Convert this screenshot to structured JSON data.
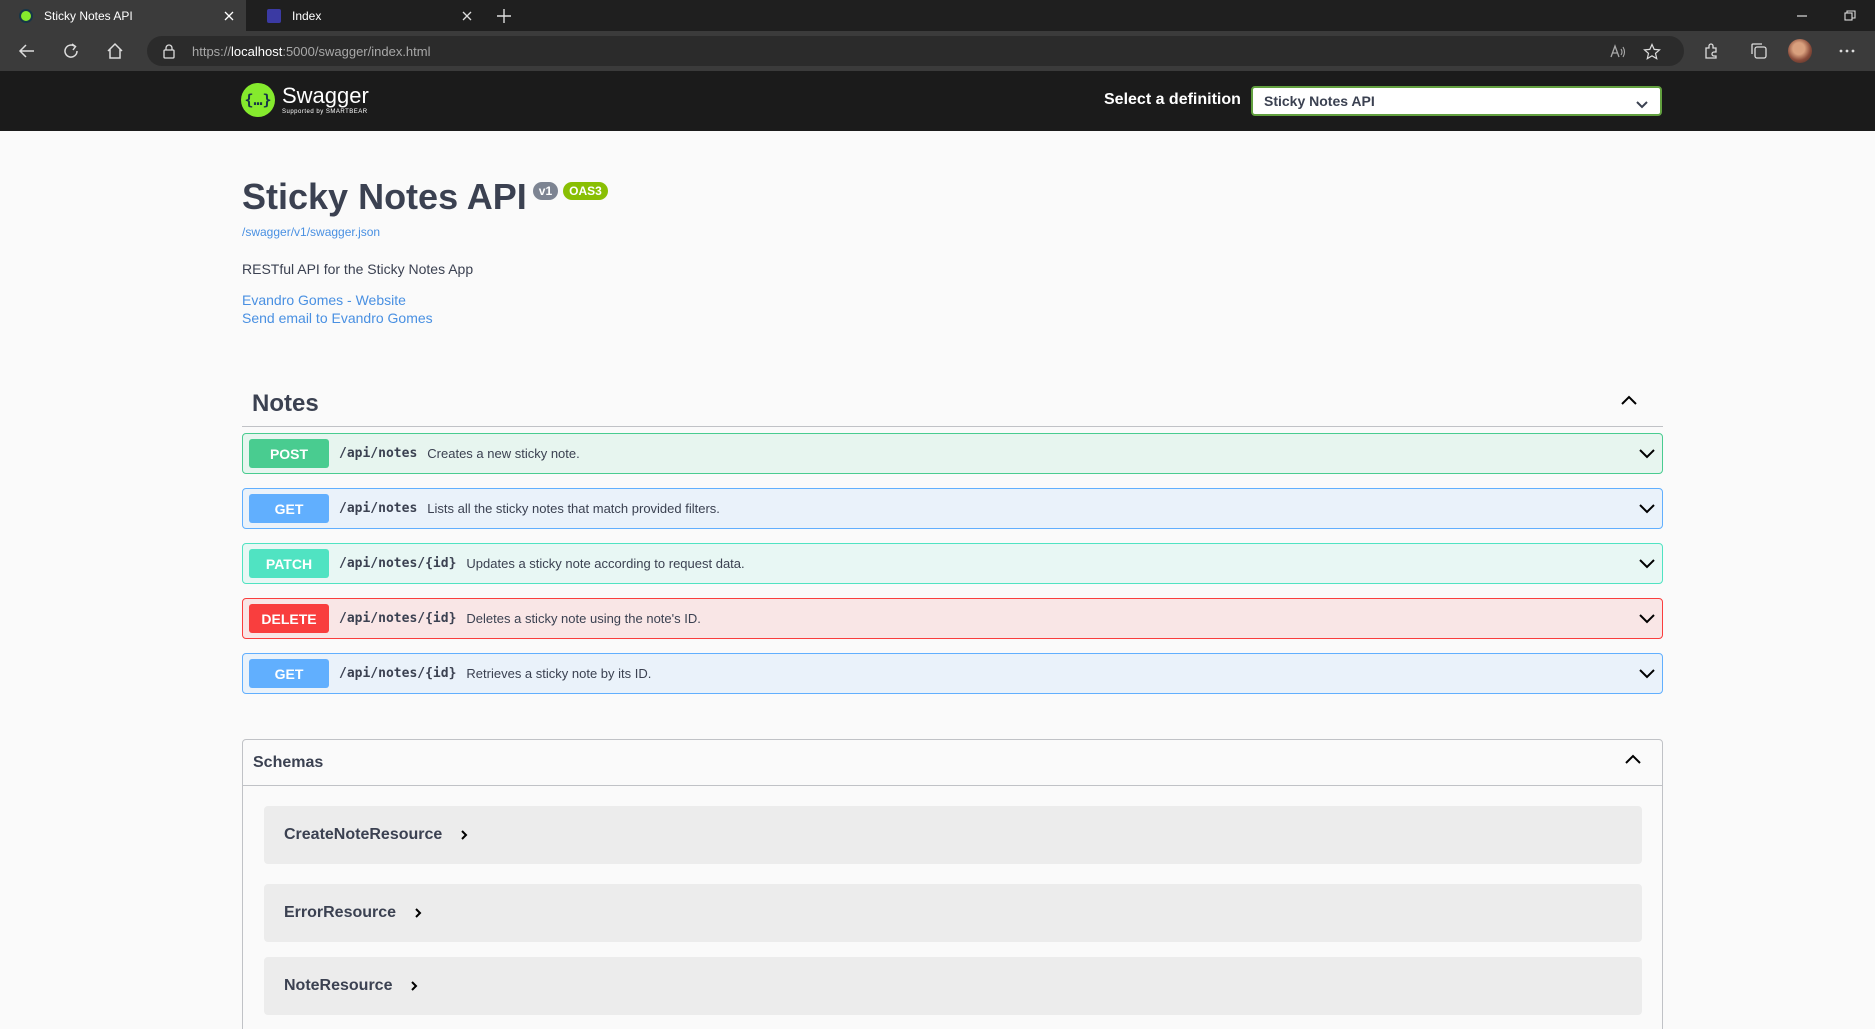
{
  "browser": {
    "tabs": [
      {
        "title": "Sticky Notes API",
        "favicon": "swagger-favicon",
        "active": true
      },
      {
        "title": "Index",
        "favicon": "index-favicon",
        "active": false
      }
    ],
    "url_prefix": "https://",
    "url_host": "localhost",
    "url_rest": ":5000/swagger/index.html"
  },
  "swagger": {
    "logo_name": "Swagger",
    "logo_sub": "Supported by SMARTBEAR",
    "definition_label": "Select a definition",
    "definition_selected": "Sticky Notes API"
  },
  "info": {
    "title": "Sticky Notes API",
    "version_badge": "v1",
    "oas_badge": "OAS3",
    "spec_link": "/swagger/v1/swagger.json",
    "description": "RESTful API for the Sticky Notes App",
    "contact_website": "Evandro Gomes - Website",
    "contact_email": "Send email to Evandro Gomes"
  },
  "tag": {
    "name": "Notes"
  },
  "operations": [
    {
      "method": "POST",
      "path": "/api/notes",
      "summary": "Creates a new sticky note."
    },
    {
      "method": "GET",
      "path": "/api/notes",
      "summary": "Lists all the sticky notes that match provided filters."
    },
    {
      "method": "PATCH",
      "path": "/api/notes/{id}",
      "summary": "Updates a sticky note according to request data."
    },
    {
      "method": "DELETE",
      "path": "/api/notes/{id}",
      "summary": "Deletes a sticky note using the note's ID."
    },
    {
      "method": "GET",
      "path": "/api/notes/{id}",
      "summary": "Retrieves a sticky note by its ID."
    }
  ],
  "schemas": {
    "title": "Schemas",
    "models": [
      "CreateNoteResource",
      "ErrorResource",
      "NoteResource"
    ]
  },
  "colors": {
    "post": "#49cc90",
    "get": "#61affe",
    "patch": "#50e3c2",
    "delete": "#f93e3e",
    "link": "#4990e2",
    "swagger_green": "#85ea2d"
  }
}
